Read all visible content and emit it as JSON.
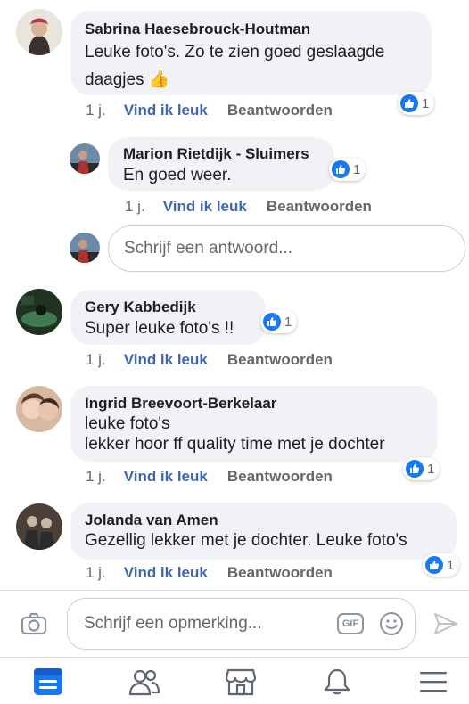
{
  "comments": [
    {
      "author": "Sabrina Haesebrouck-Houtman",
      "text_lines": [
        "Leuke foto's. Zo te zien goed geslaagde",
        "daagjes 👍"
      ],
      "time": "1 j.",
      "like_label": "Vind ik leuk",
      "reply_label": "Beantwoorden",
      "reaction_count": "1",
      "avatar_colors": [
        "#e9e4dc",
        "#b23a48",
        "#3b2f2f"
      ]
    },
    {
      "author": "Marion Rietdijk - Sluimers",
      "text_lines": [
        "En goed weer."
      ],
      "time": "1 j.",
      "like_label": "Vind ik leuk",
      "reply_label": "Beantwoorden",
      "reaction_count": "1",
      "avatar_colors": [
        "#6b8aa8",
        "#b03030",
        "#2a2a2a"
      ]
    },
    {
      "author": "Gery Kabbedijk",
      "text_lines": [
        "Super leuke foto's !!"
      ],
      "time": "1 j.",
      "like_label": "Vind ik leuk",
      "reply_label": "Beantwoorden",
      "reaction_count": "1",
      "avatar_colors": [
        "#1f3320",
        "#3f7a52",
        "#0d1a12"
      ]
    },
    {
      "author": "Ingrid Breevoort-Berkelaar",
      "text_lines": [
        "leuke foto's",
        "lekker hoor ff quality time met je dochter"
      ],
      "time": "1 j.",
      "like_label": "Vind ik leuk",
      "reply_label": "Beantwoorden",
      "reaction_count": "1",
      "avatar_colors": [
        "#d9b8a2",
        "#5a3b2c",
        "#f0d2c0"
      ]
    },
    {
      "author": "Jolanda van Amen",
      "text_lines": [
        "Gezellig lekker met je dochter. Leuke foto's"
      ],
      "time": "1 j.",
      "like_label": "Vind ik leuk",
      "reply_label": "Beantwoorden",
      "reaction_count": "1",
      "avatar_colors": [
        "#4a4038",
        "#2b2b2b",
        "#c7b8a6"
      ]
    }
  ],
  "reply_box": {
    "placeholder": "Schrijf een antwoord..."
  },
  "composer": {
    "placeholder": "Schrijf een opmerking...",
    "gif_label": "GIF"
  },
  "icons": {
    "camera": "camera-icon",
    "gif": "gif-icon",
    "emoji": "emoji-icon",
    "send": "send-icon",
    "reaction": "like-thumb-icon"
  },
  "tabs": [
    {
      "name": "news-feed",
      "icon": "news-feed-icon",
      "active": true
    },
    {
      "name": "friends",
      "icon": "friends-icon",
      "active": false
    },
    {
      "name": "marketplace",
      "icon": "marketplace-icon",
      "active": false
    },
    {
      "name": "notifications",
      "icon": "bell-icon",
      "active": false
    },
    {
      "name": "menu",
      "icon": "menu-icon",
      "active": false
    }
  ],
  "colors": {
    "accent": "#4267b2",
    "reaction_blue": "#1877f2",
    "bubble": "#f0f2f5",
    "muted": "#65676b",
    "tab_active": "#1877f2",
    "tab_inactive": "#606770"
  }
}
